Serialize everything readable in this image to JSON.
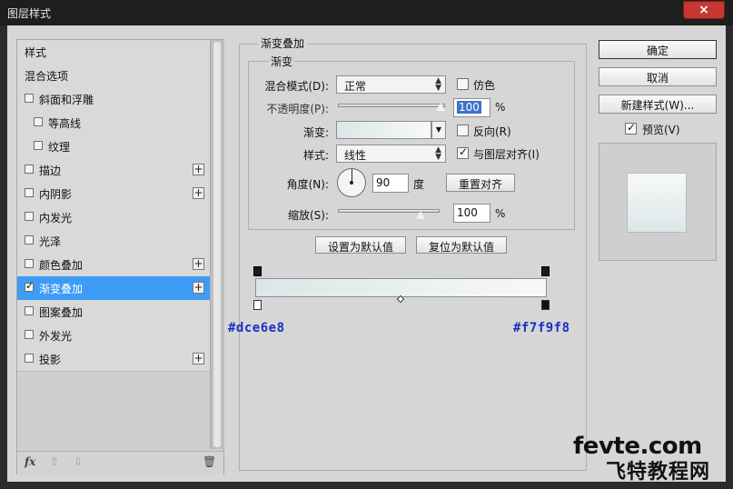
{
  "window": {
    "title": "图层样式",
    "close_glyph": "×"
  },
  "style_list": {
    "items": [
      {
        "label": "样式",
        "checkbox": false,
        "checked": false,
        "plus": false,
        "selected": false,
        "indent": 0
      },
      {
        "label": "混合选项",
        "checkbox": false,
        "checked": false,
        "plus": false,
        "selected": false,
        "indent": 0
      },
      {
        "label": "斜面和浮雕",
        "checkbox": true,
        "checked": false,
        "plus": false,
        "selected": false,
        "indent": 0
      },
      {
        "label": "等高线",
        "checkbox": true,
        "checked": false,
        "plus": false,
        "selected": false,
        "indent": 1
      },
      {
        "label": "纹理",
        "checkbox": true,
        "checked": false,
        "plus": false,
        "selected": false,
        "indent": 1
      },
      {
        "label": "描边",
        "checkbox": true,
        "checked": false,
        "plus": true,
        "selected": false,
        "indent": 0
      },
      {
        "label": "内阴影",
        "checkbox": true,
        "checked": false,
        "plus": true,
        "selected": false,
        "indent": 0
      },
      {
        "label": "内发光",
        "checkbox": true,
        "checked": false,
        "plus": false,
        "selected": false,
        "indent": 0
      },
      {
        "label": "光泽",
        "checkbox": true,
        "checked": false,
        "plus": false,
        "selected": false,
        "indent": 0
      },
      {
        "label": "颜色叠加",
        "checkbox": true,
        "checked": false,
        "plus": true,
        "selected": false,
        "indent": 0
      },
      {
        "label": "渐变叠加",
        "checkbox": true,
        "checked": true,
        "plus": true,
        "selected": true,
        "indent": 0
      },
      {
        "label": "图案叠加",
        "checkbox": true,
        "checked": false,
        "plus": false,
        "selected": false,
        "indent": 0
      },
      {
        "label": "外发光",
        "checkbox": true,
        "checked": false,
        "plus": false,
        "selected": false,
        "indent": 0
      },
      {
        "label": "投影",
        "checkbox": true,
        "checked": false,
        "plus": true,
        "selected": false,
        "indent": 0
      }
    ],
    "toolbar": {
      "fx": "fx",
      "up": "⇧",
      "down": "⇩",
      "trash": "🗑"
    },
    "icons": {
      "plus": "plus-icon",
      "fx": "fx-icon",
      "up": "move-up-icon",
      "down": "move-down-icon",
      "trash": "trash-icon"
    }
  },
  "panel": {
    "group_title": "渐变叠加",
    "sub_title": "渐变",
    "blend_mode": {
      "label": "混合模式(D):",
      "value": "正常"
    },
    "dither": {
      "label": "仿色",
      "checked": false
    },
    "opacity": {
      "label": "不透明度(P):",
      "value": "100",
      "unit": "%",
      "level": 100
    },
    "gradient": {
      "label": "渐变:",
      "from_color": "#dce6e8",
      "to_color": "#f7f9f8"
    },
    "reverse": {
      "label": "反向(R)",
      "checked": false
    },
    "style": {
      "label": "样式:",
      "value": "线性"
    },
    "align_layer": {
      "label": "与图层对齐(I)",
      "checked": true
    },
    "angle": {
      "label": "角度(N):",
      "value": "90",
      "unit": "度",
      "degrees": 90
    },
    "reset_align": "重置对齐",
    "scale": {
      "label": "缩放(S):",
      "value": "100",
      "unit": "%",
      "level": 100
    },
    "make_default": "设置为默认值",
    "reset_default": "复位为默认值"
  },
  "gradient_editor": {
    "left_hex": "#dce6e8",
    "right_hex": "#f7f9f8",
    "stop_left_color": "#ffffff",
    "stop_right_color": "#111111",
    "midpoint": 0.5
  },
  "buttons": {
    "ok": "确定",
    "cancel": "取消",
    "new_style": "新建样式(W)...",
    "preview": {
      "label": "预览(V)",
      "checked": true
    }
  },
  "watermark": {
    "line1": "fevte.com",
    "line2": "飞特教程网"
  }
}
